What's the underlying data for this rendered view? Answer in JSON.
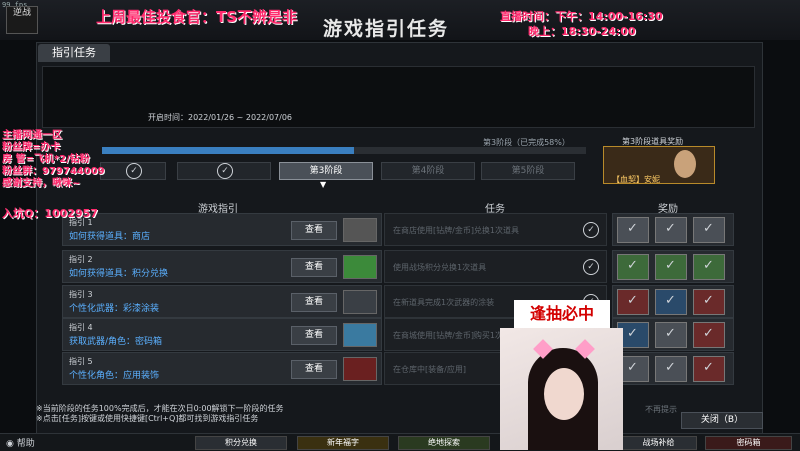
{
  "overlay": {
    "fps": "99 fps",
    "game_logo": "逆战",
    "title": "上周最佳投食官：TS不辨是非",
    "schedule_weekday": "直播时间：下午：14:00-16:30",
    "schedule_evening": "晚上：18:30-24:00",
    "streamer_info": [
      "主播网通一区",
      "粉丝牌=办卡",
      "房 管=飞机*2/钻粉",
      "粉丝群：979744009",
      "感谢支持，啾咪~"
    ],
    "qq_group": "入坑Q：1002957",
    "cam_title": "逢抽必中"
  },
  "window": {
    "title": "游戏指引任务",
    "tab": "指引任务",
    "period": "开启时间：2022/01/26 ~ 2022/07/06",
    "progress_text": "第3阶段（已完成58%）",
    "progress_fraction": 0.52,
    "stages": [
      {
        "label": "",
        "active": false
      },
      {
        "label": "",
        "active": false
      },
      {
        "label": "第3阶段",
        "active": true
      },
      {
        "label": "第4阶段",
        "active": false
      },
      {
        "label": "第5阶段",
        "active": false
      }
    ],
    "reward_label": "第3阶段道具奖励",
    "reward_name": "【血契】安妮",
    "col_guide": "游戏指引",
    "col_task": "任务",
    "col_reward": "奖励",
    "view_label": "查看",
    "rows": [
      {
        "num": "指引 1",
        "name": "如何获得道具：商店",
        "task": "在商店使用[钻牌/金币]兑换1次道具",
        "thumb": "#555",
        "rewards": [
          "",
          "",
          ""
        ]
      },
      {
        "num": "指引 2",
        "name": "如何获得道具：积分兑换",
        "task": "使用战场积分兑换1次道具",
        "thumb": "#3c8a3a",
        "rewards": [
          "g",
          "g",
          "g"
        ]
      },
      {
        "num": "指引 3",
        "name": "个性化武器：彩漆涂装",
        "task": "在新道具完成1次武器的涂装",
        "thumb": "#3a3f45",
        "rewards": [
          "r",
          "b",
          "r"
        ]
      },
      {
        "num": "指引 4",
        "name": "获取武器/角色：密码箱",
        "task": "在商城使用[钻牌/金币]购买1次",
        "thumb": "#3a7aa0",
        "rewards": [
          "b",
          "",
          "r"
        ]
      },
      {
        "num": "指引 5",
        "name": "个性化角色：应用装饰",
        "task": "在仓库中[装备/应用]",
        "thumb": "#6a2020",
        "rewards": [
          "",
          "",
          "r"
        ]
      }
    ],
    "notes": [
      "※当前阶段的任务100%完成后，才能在次日0:00解锁下一阶段的任务",
      "※点击[任务]按键或使用快捷键[Ctrl+Q]都可找到游戏指引任务"
    ],
    "close_label": "关闭（B）",
    "check_label": "不再提示"
  },
  "bottom": {
    "help": "帮助",
    "buttons": [
      "积分兑换",
      "新年福字",
      "绝地探索",
      "战场补给",
      "密码箱"
    ]
  }
}
